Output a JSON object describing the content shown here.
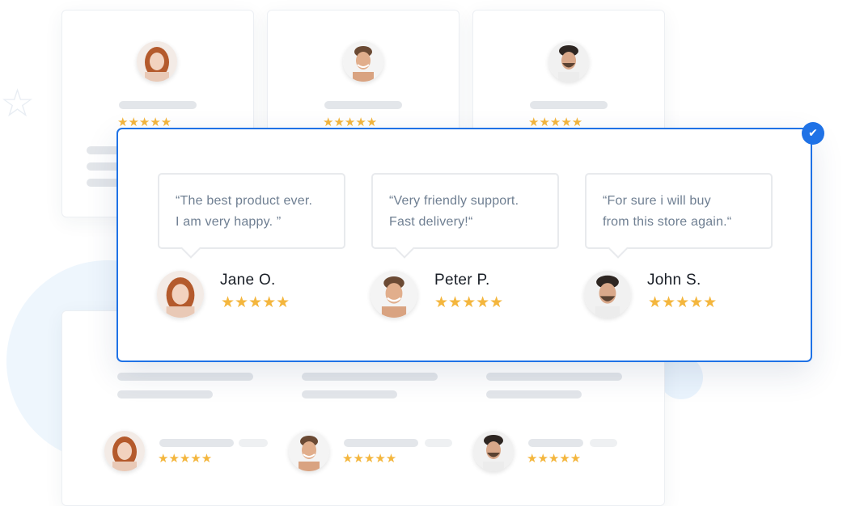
{
  "colors": {
    "accent": "#1f72e6",
    "star": "#f4b63d",
    "quote_text": "#6f7f92",
    "name_text": "#1a1f27"
  },
  "badge": {
    "icon": "check-icon",
    "glyph": "✔"
  },
  "reviews": [
    {
      "line1": "“The best product ever.",
      "line2": "I am very happy. ”",
      "name": "Jane O.",
      "avatar": "woman-redhead",
      "stars": "★★★★★"
    },
    {
      "line1": "“Very friendly support.",
      "line2": "Fast delivery!“",
      "name": "Peter P.",
      "avatar": "man-smiling",
      "stars": "★★★★★"
    },
    {
      "line1": "“For sure i will buy",
      "line2": "from this store again.“",
      "name": "John S.",
      "avatar": "man-beard",
      "stars": "★★★★★"
    }
  ],
  "background_stars": "★★★★★",
  "decor_star": "☆"
}
